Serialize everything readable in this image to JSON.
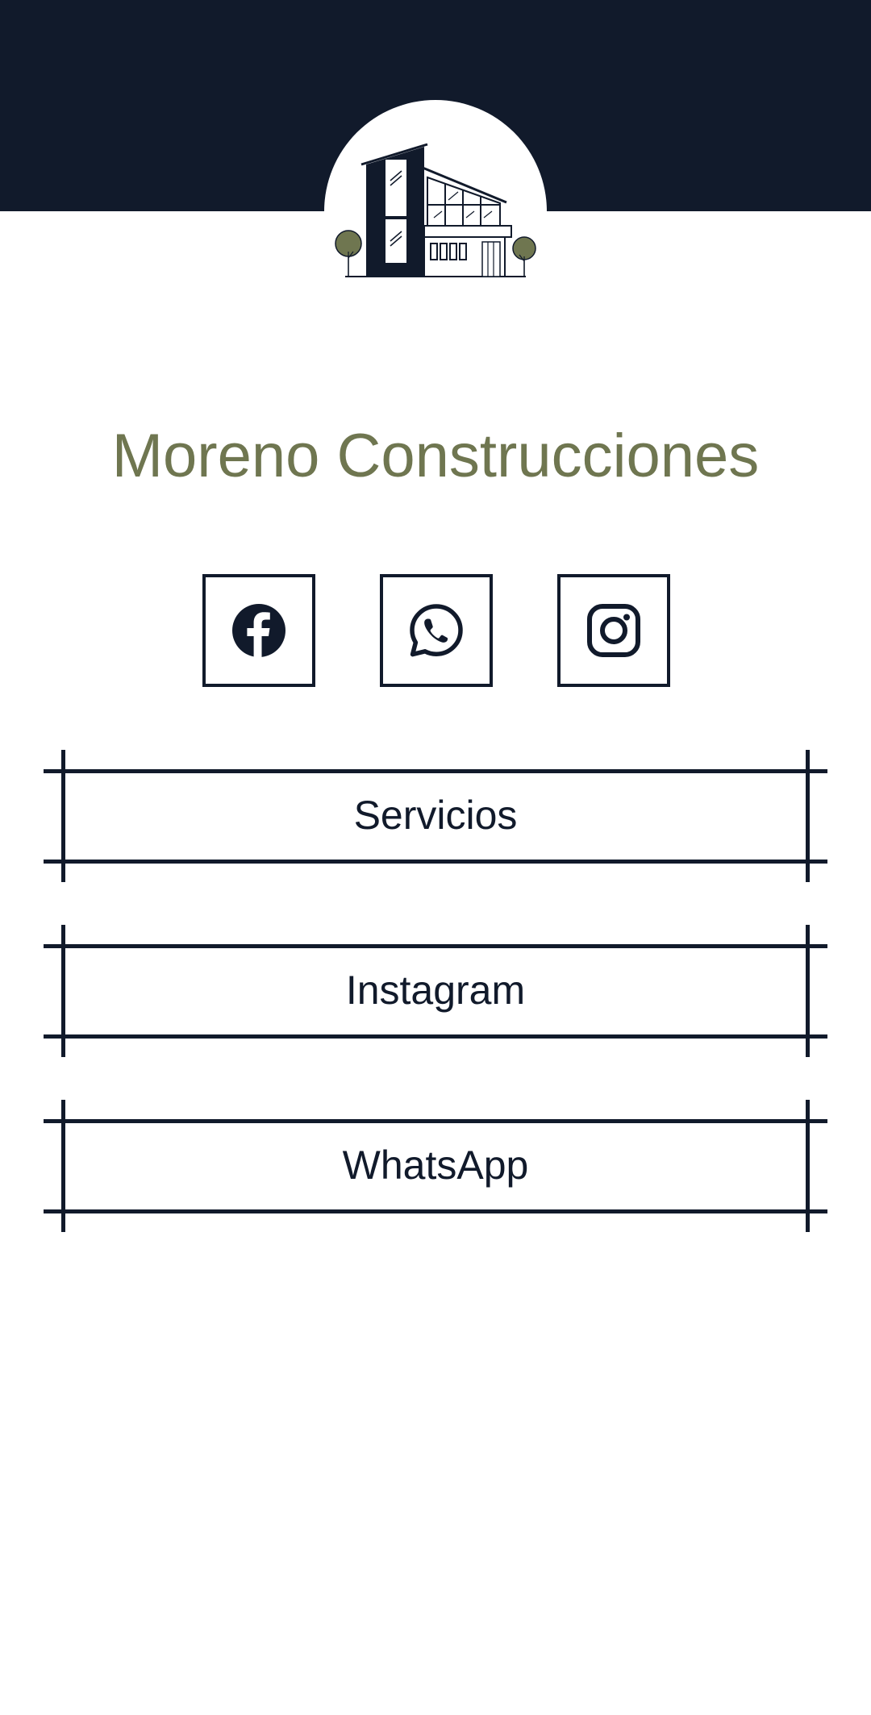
{
  "brand": {
    "name": "Moreno Construcciones",
    "logo_icon": "modern-house-logo"
  },
  "colors": {
    "navy": "#111a2b",
    "olive": "#6f7650",
    "background": "#ffffff"
  },
  "social": [
    {
      "name": "facebook",
      "icon": "facebook-icon"
    },
    {
      "name": "whatsapp",
      "icon": "whatsapp-icon"
    },
    {
      "name": "instagram",
      "icon": "instagram-icon"
    }
  ],
  "links": [
    {
      "label": "Servicios"
    },
    {
      "label": "Instagram"
    },
    {
      "label": "WhatsApp"
    }
  ]
}
